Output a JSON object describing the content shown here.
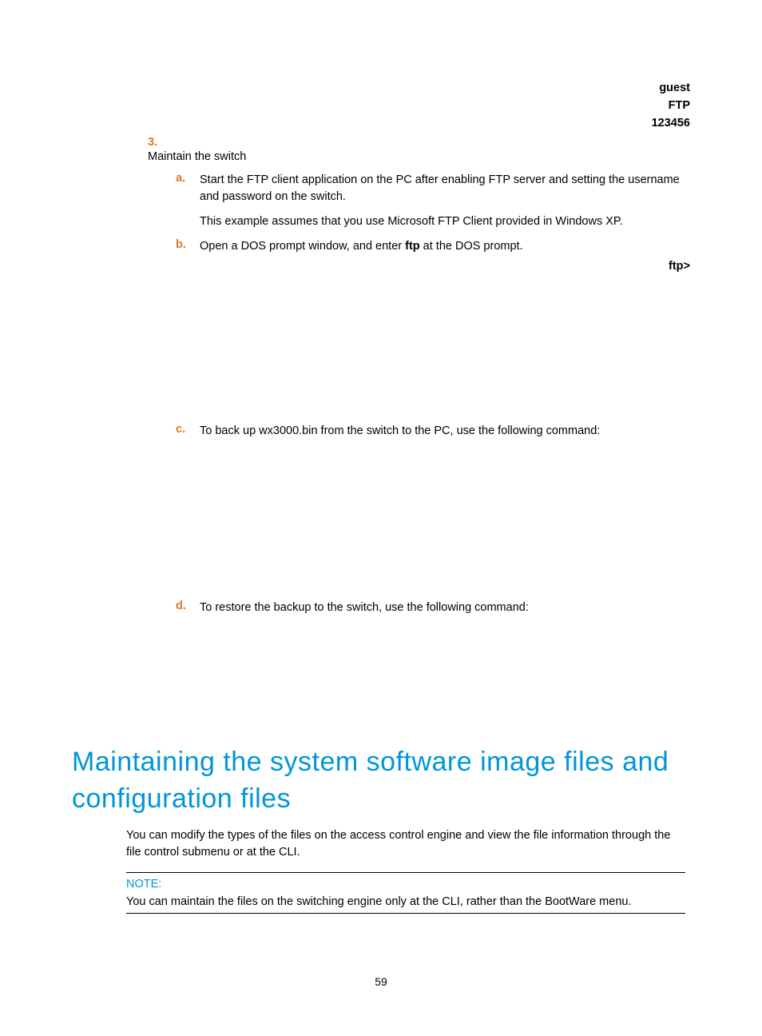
{
  "topRight": {
    "line1": "guest",
    "line2": "FTP",
    "line3": "123456"
  },
  "step3": {
    "num": "3.",
    "text": "Maintain the switch",
    "a": {
      "letter": "a.",
      "text": "Start the FTP client application on the PC after enabling FTP server and setting the username and password on the switch.",
      "assume": "This example assumes that you use Microsoft FTP Client provided in Windows XP."
    },
    "b": {
      "letter": "b.",
      "prefix": "Open a DOS prompt window, and enter ",
      "bold": "ftp",
      "suffix": " at the DOS prompt."
    },
    "ftpPrompt": "ftp>",
    "c": {
      "letter": "c.",
      "text": "To back up wx3000.bin from the switch to the PC, use the following command:"
    },
    "d": {
      "letter": "d.",
      "text": "To restore the backup to the switch, use the following command:"
    }
  },
  "heading": "Maintaining the system software image files and configuration files",
  "bodyPara": "You can modify the types of the files on the access control engine and view the file information through the file control submenu or at the CLI.",
  "note": {
    "label": "NOTE:",
    "text": "You can maintain the files on the switching engine only at the CLI, rather than the BootWare menu."
  },
  "pageNum": "59"
}
